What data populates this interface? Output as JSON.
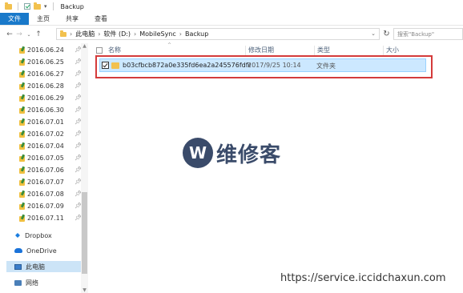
{
  "window": {
    "title": "Backup"
  },
  "ribbon": {
    "tabs": [
      "文件",
      "主页",
      "共享",
      "查看"
    ]
  },
  "address": {
    "crumbs": [
      "此电脑",
      "软件 (D:)",
      "MobileSync",
      "Backup"
    ],
    "search_placeholder": "搜索\"Backup\""
  },
  "nav": {
    "folders": [
      "2016.06.24",
      "2016.06.25",
      "2016.06.27",
      "2016.06.28",
      "2016.06.29",
      "2016.06.30",
      "2016.07.01",
      "2016.07.02",
      "2016.07.04",
      "2016.07.05",
      "2016.07.06",
      "2016.07.07",
      "2016.07.08",
      "2016.07.09",
      "2016.07.11"
    ],
    "locations": [
      {
        "label": "Dropbox",
        "icon": "dropbox-icon"
      },
      {
        "label": "OneDrive",
        "icon": "onedrive-icon"
      },
      {
        "label": "此电脑",
        "icon": "pc-icon",
        "selected": true
      },
      {
        "label": "网络",
        "icon": "network-icon"
      }
    ]
  },
  "columns": {
    "name": "名称",
    "date": "修改日期",
    "type": "类型",
    "size": "大小"
  },
  "files": [
    {
      "name": "b03cfbcb872a0e335fd6ea2a245576fdfef...",
      "date": "2017/9/25 10:14",
      "type": "文件夹",
      "size": "",
      "checked": true
    }
  ],
  "watermark": {
    "logo": "W",
    "text": "维修客"
  },
  "footer_url": "https://service.iccidchaxun.com"
}
